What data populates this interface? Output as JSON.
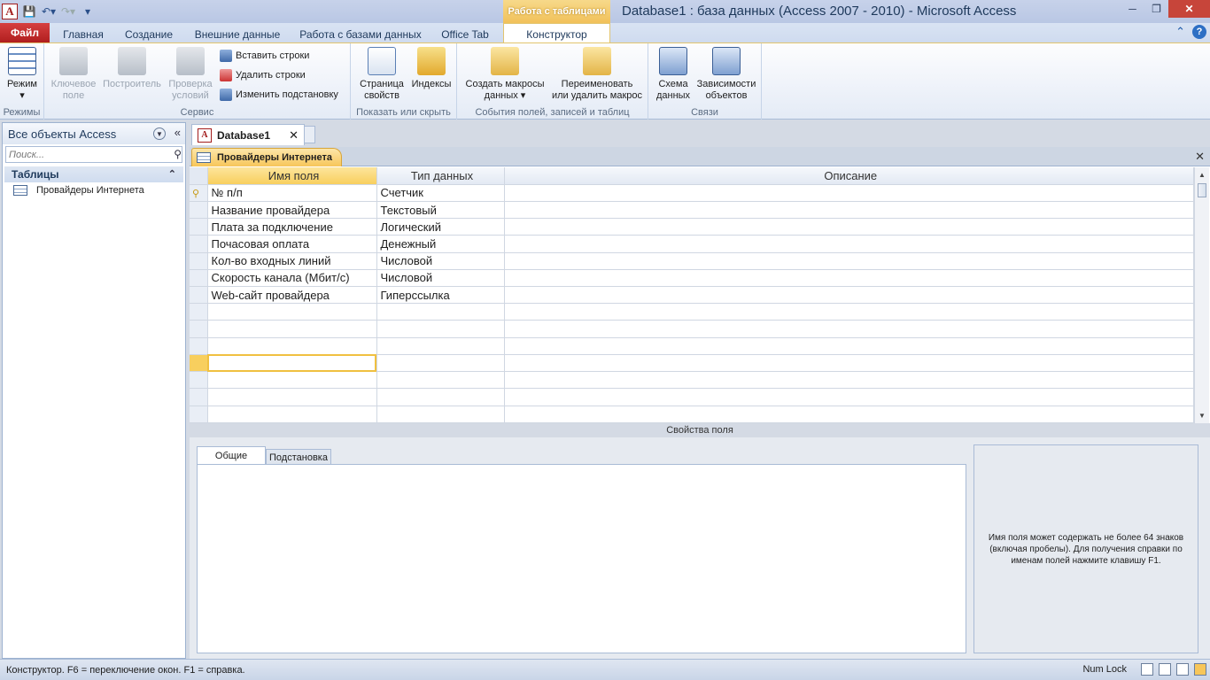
{
  "app": {
    "window_title": "Database1 : база данных (Access 2007 - 2010)  -  Microsoft Access",
    "context_tab_header": "Работа с таблицами",
    "logo_letter": "A"
  },
  "ribbon_tabs": [
    "Файл",
    "Главная",
    "Создание",
    "Внешние данные",
    "Работа с базами данных",
    "Office Tab",
    "Конструктор"
  ],
  "ribbon": {
    "groups": {
      "modes": "Режимы",
      "service": "Сервис",
      "show_hide": "Показать или скрыть",
      "events": "События полей, записей и таблиц",
      "relations": "Связи"
    },
    "mode_l1": "Режим",
    "key_l1": "Ключевое",
    "key_l2": "поле",
    "builder": "Построитель",
    "validate_l1": "Проверка",
    "validate_l2": "условий",
    "insert_rows": "Вставить строки",
    "delete_rows": "Удалить строки",
    "change_lookup": "Изменить подстановку",
    "prop_sheet_l1": "Страница",
    "prop_sheet_l2": "свойств",
    "indexes": "Индексы",
    "create_macro_l1": "Создать макросы",
    "create_macro_l2": "данных",
    "rename_macro_l1": "Переименовать",
    "rename_macro_l2": "или удалить макрос",
    "schema_l1": "Схема",
    "schema_l2": "данных",
    "deps_l1": "Зависимости",
    "deps_l2": "объектов"
  },
  "nav": {
    "title": "Все объекты Access",
    "search_placeholder": "Поиск...",
    "group": "Таблицы",
    "items": [
      "Провайдеры Интернета"
    ]
  },
  "doc": {
    "tab": "Database1",
    "object_tab": "Провайдеры Интернета",
    "columns": [
      "Имя поля",
      "Тип данных",
      "Описание"
    ],
    "rows": [
      {
        "name": "№ п/п",
        "type": "Счетчик",
        "desc": "",
        "key": true
      },
      {
        "name": "Название провайдера",
        "type": "Текстовый",
        "desc": ""
      },
      {
        "name": "Плата за подключение",
        "type": "Логический",
        "desc": ""
      },
      {
        "name": "Почасовая оплата",
        "type": "Денежный",
        "desc": ""
      },
      {
        "name": "Кол-во входных линий",
        "type": "Числовой",
        "desc": ""
      },
      {
        "name": "Скорость канала (Мбит/с)",
        "type": "Числовой",
        "desc": ""
      },
      {
        "name": "Web-сайт провайдера",
        "type": "Гиперссылка",
        "desc": ""
      }
    ],
    "props_label": "Свойства поля",
    "tab_general": "Общие",
    "tab_lookup": "Подстановка",
    "help_text": "Имя поля может содержать не более 64 знаков (включая пробелы). Для получения справки по именам полей нажмите клавишу F1."
  },
  "status": {
    "left": "Конструктор.  F6 = переключение окон.  F1 = справка.",
    "numlock": "Num Lock"
  },
  "colors": {
    "accent": "#f7c65a",
    "file_tab": "#c62828",
    "ribbon_bg": "#e4ebf6"
  }
}
